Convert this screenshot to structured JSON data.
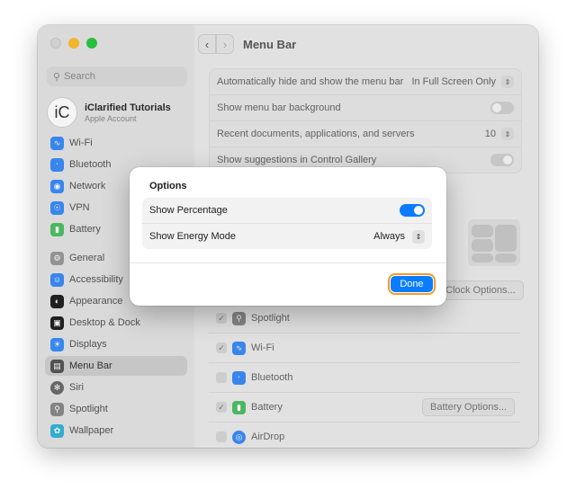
{
  "window": {
    "title": "Menu Bar"
  },
  "sidebar": {
    "search_placeholder": "Search",
    "account": {
      "initials": "iC",
      "name": "iClarified Tutorials",
      "subtitle": "Apple Account"
    },
    "items": [
      {
        "label": "Wi-Fi",
        "icon": "wifi-icon",
        "color": "#3b8cf7"
      },
      {
        "label": "Bluetooth",
        "icon": "bluetooth-icon",
        "color": "#3b8cf7"
      },
      {
        "label": "Network",
        "icon": "globe-icon",
        "color": "#3b8cf7"
      },
      {
        "label": "VPN",
        "icon": "vpn-icon",
        "color": "#3b8cf7"
      },
      {
        "label": "Battery",
        "icon": "battery-icon",
        "color": "#4cc064"
      },
      {
        "label": "General",
        "icon": "gear-icon",
        "color": "#9a9a9a"
      },
      {
        "label": "Accessibility",
        "icon": "accessibility-icon",
        "color": "#3b8cf7"
      },
      {
        "label": "Appearance",
        "icon": "appearance-icon",
        "color": "#222222"
      },
      {
        "label": "Desktop & Dock",
        "icon": "dock-icon",
        "color": "#222222"
      },
      {
        "label": "Displays",
        "icon": "sun-icon",
        "color": "#3b8cf7"
      },
      {
        "label": "Menu Bar",
        "icon": "menubar-icon",
        "color": "#555555"
      },
      {
        "label": "Siri",
        "icon": "siri-icon",
        "color": "#6b6b6b"
      },
      {
        "label": "Spotlight",
        "icon": "spotlight-icon",
        "color": "#8a8a8a"
      },
      {
        "label": "Wallpaper",
        "icon": "wallpaper-icon",
        "color": "#36b5d8"
      }
    ]
  },
  "settings": {
    "auto_hide_label": "Automatically hide and show the menu bar",
    "auto_hide_value": "In Full Screen Only",
    "background_label": "Show menu bar background",
    "recent_label": "Recent documents, applications, and servers",
    "recent_value": "10",
    "suggestions_label": "Show suggestions in Control Gallery"
  },
  "clock_options_label": "Clock Options...",
  "control_items": [
    {
      "label": "Spotlight",
      "checked": true,
      "icon": "spotlight-icon",
      "color": "#8a8a8a"
    },
    {
      "label": "Wi-Fi",
      "checked": true,
      "icon": "wifi-icon",
      "color": "#3b8cf7"
    },
    {
      "label": "Bluetooth",
      "checked": false,
      "icon": "bluetooth-icon",
      "color": "#3b8cf7"
    },
    {
      "label": "Battery",
      "checked": true,
      "icon": "battery-icon",
      "color": "#4cc064",
      "options": "Battery Options..."
    },
    {
      "label": "AirDrop",
      "checked": false,
      "icon": "airdrop-icon",
      "color": "#3b8cf7"
    }
  ],
  "dialog": {
    "title": "Options",
    "show_percentage_label": "Show Percentage",
    "show_percentage_on": true,
    "energy_mode_label": "Show Energy Mode",
    "energy_mode_value": "Always",
    "done_label": "Done"
  }
}
